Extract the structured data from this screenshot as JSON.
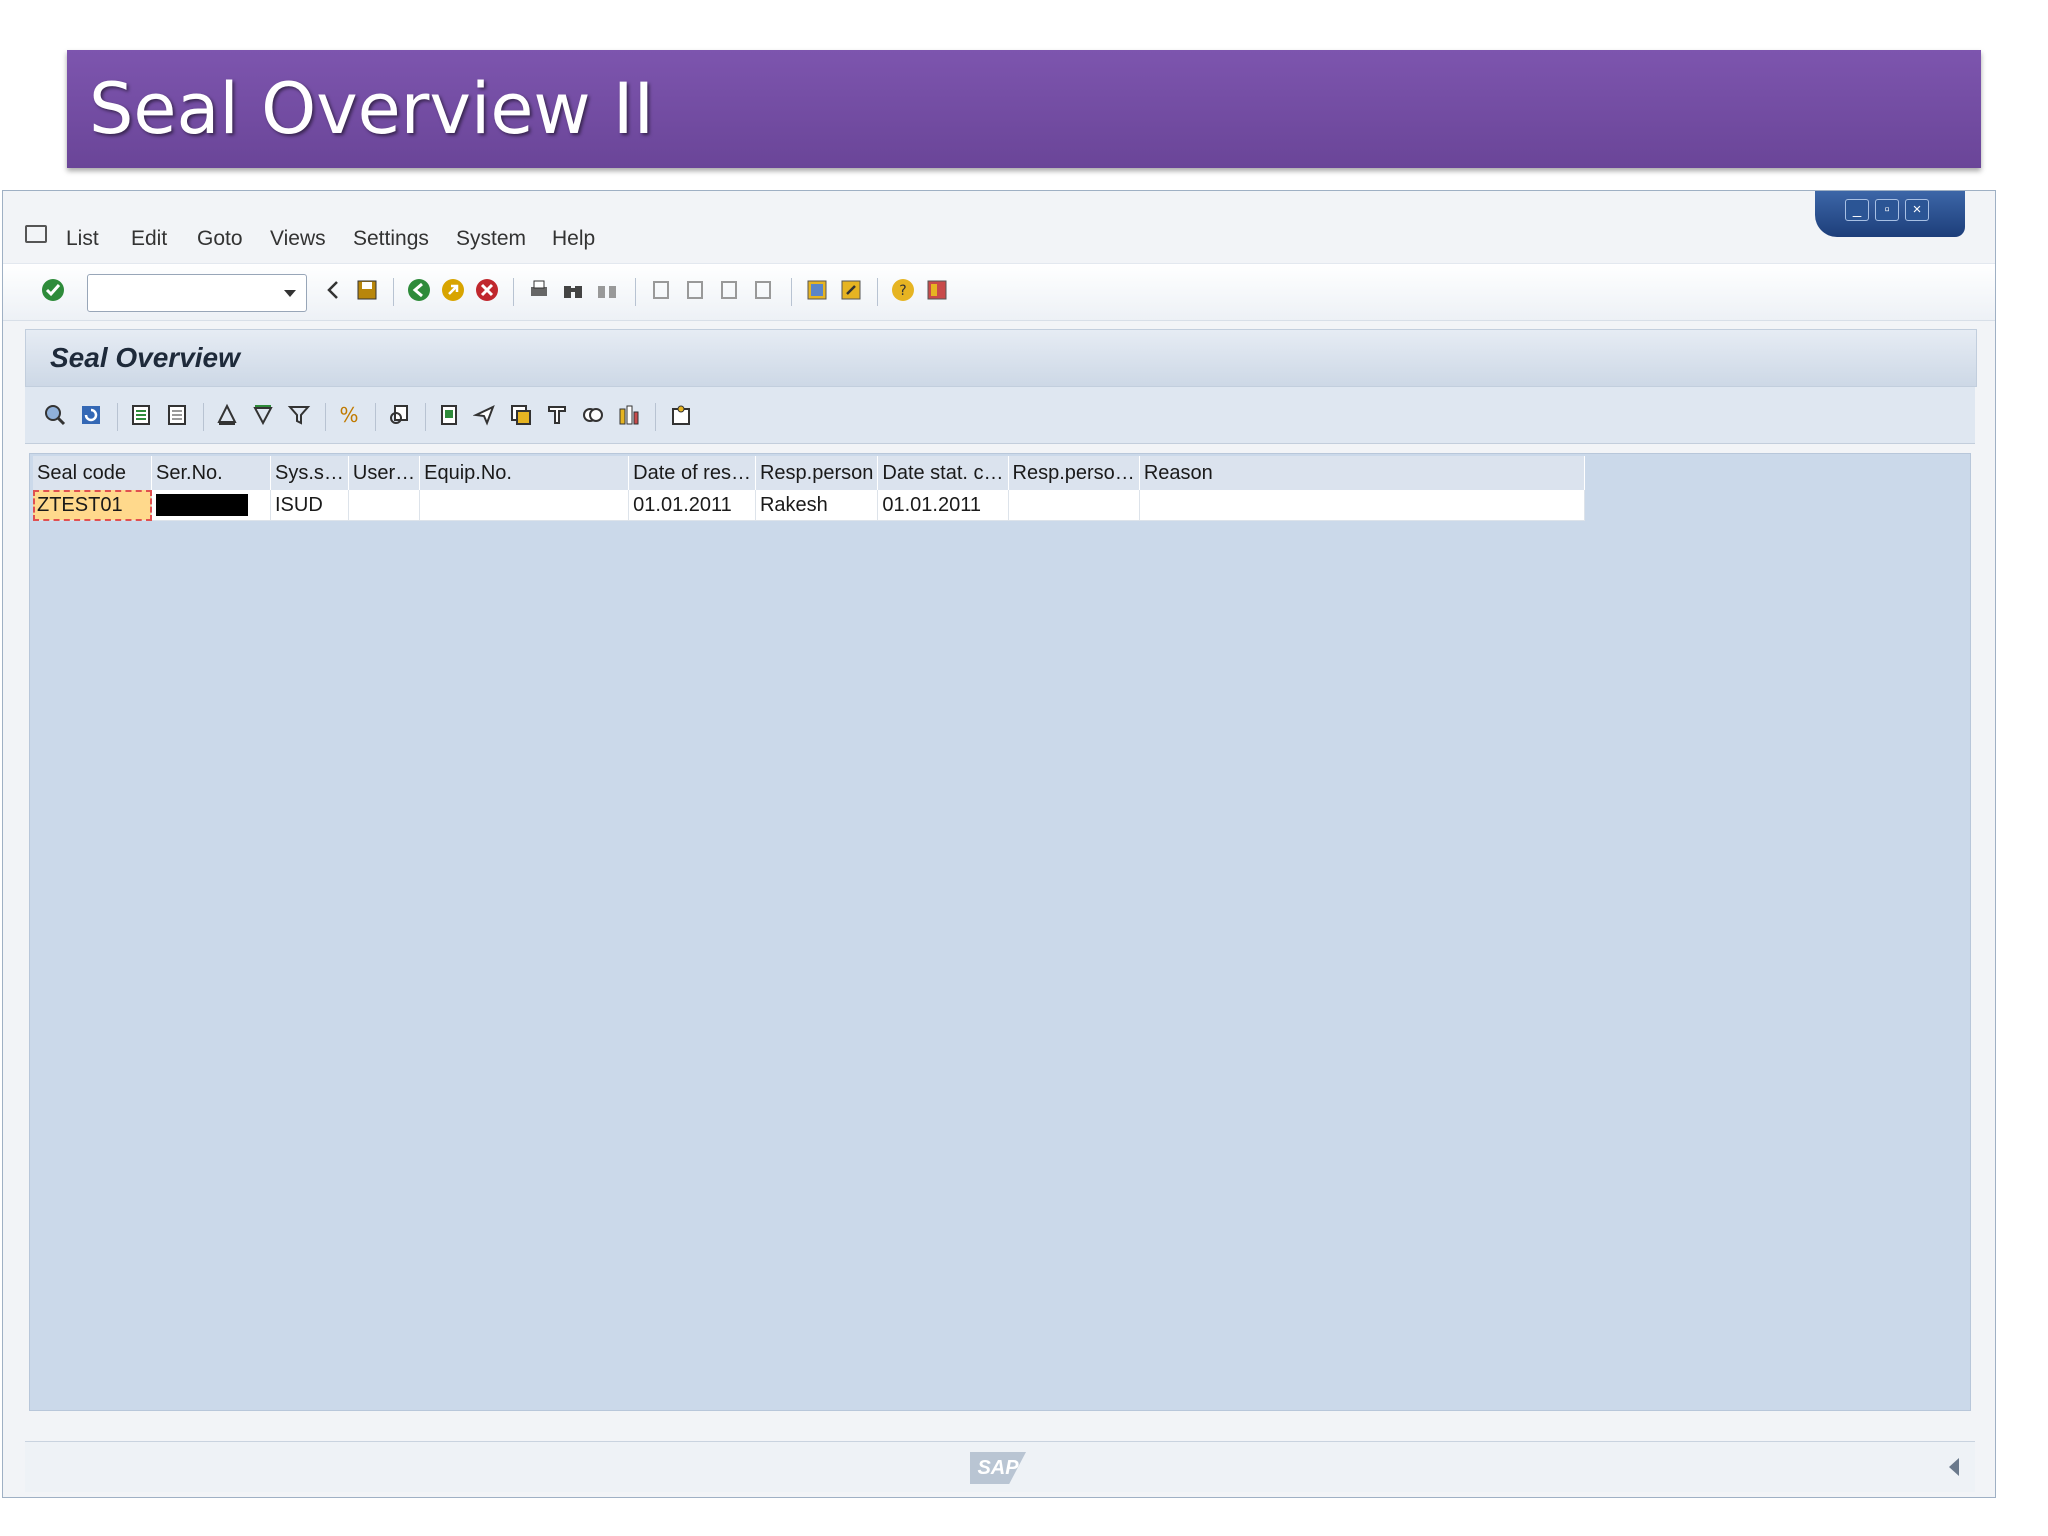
{
  "slide": {
    "title": "Seal Overview II"
  },
  "window_controls": [
    "minimize",
    "restore",
    "close"
  ],
  "menubar": {
    "items": [
      "List",
      "Edit",
      "Goto",
      "Views",
      "Settings",
      "System",
      "Help"
    ]
  },
  "toolbar": {
    "command_field_value": ""
  },
  "screen": {
    "title": "Seal Overview"
  },
  "table": {
    "columns": [
      "Seal code",
      "Ser.No.",
      "Sys.s…",
      "User…",
      "Equip.No.",
      "Date of res…",
      "Resp.person",
      "Date stat. c…",
      "Resp.perso…",
      "Reason"
    ],
    "rows": [
      {
        "seal_code": "ZTEST01",
        "ser_no": "",
        "sys_status": "ISUD",
        "user": "",
        "equip_no": "",
        "date_res": "01.01.2011",
        "resp_person": "Rakesh",
        "date_stat": "01.01.2011",
        "resp_person2": "",
        "reason": ""
      }
    ]
  },
  "statusbar": {
    "logo": "SAP"
  },
  "colors": {
    "banner": "#7151a0",
    "content_bg": "#cbd9ea",
    "highlight": "#ffd98c"
  }
}
